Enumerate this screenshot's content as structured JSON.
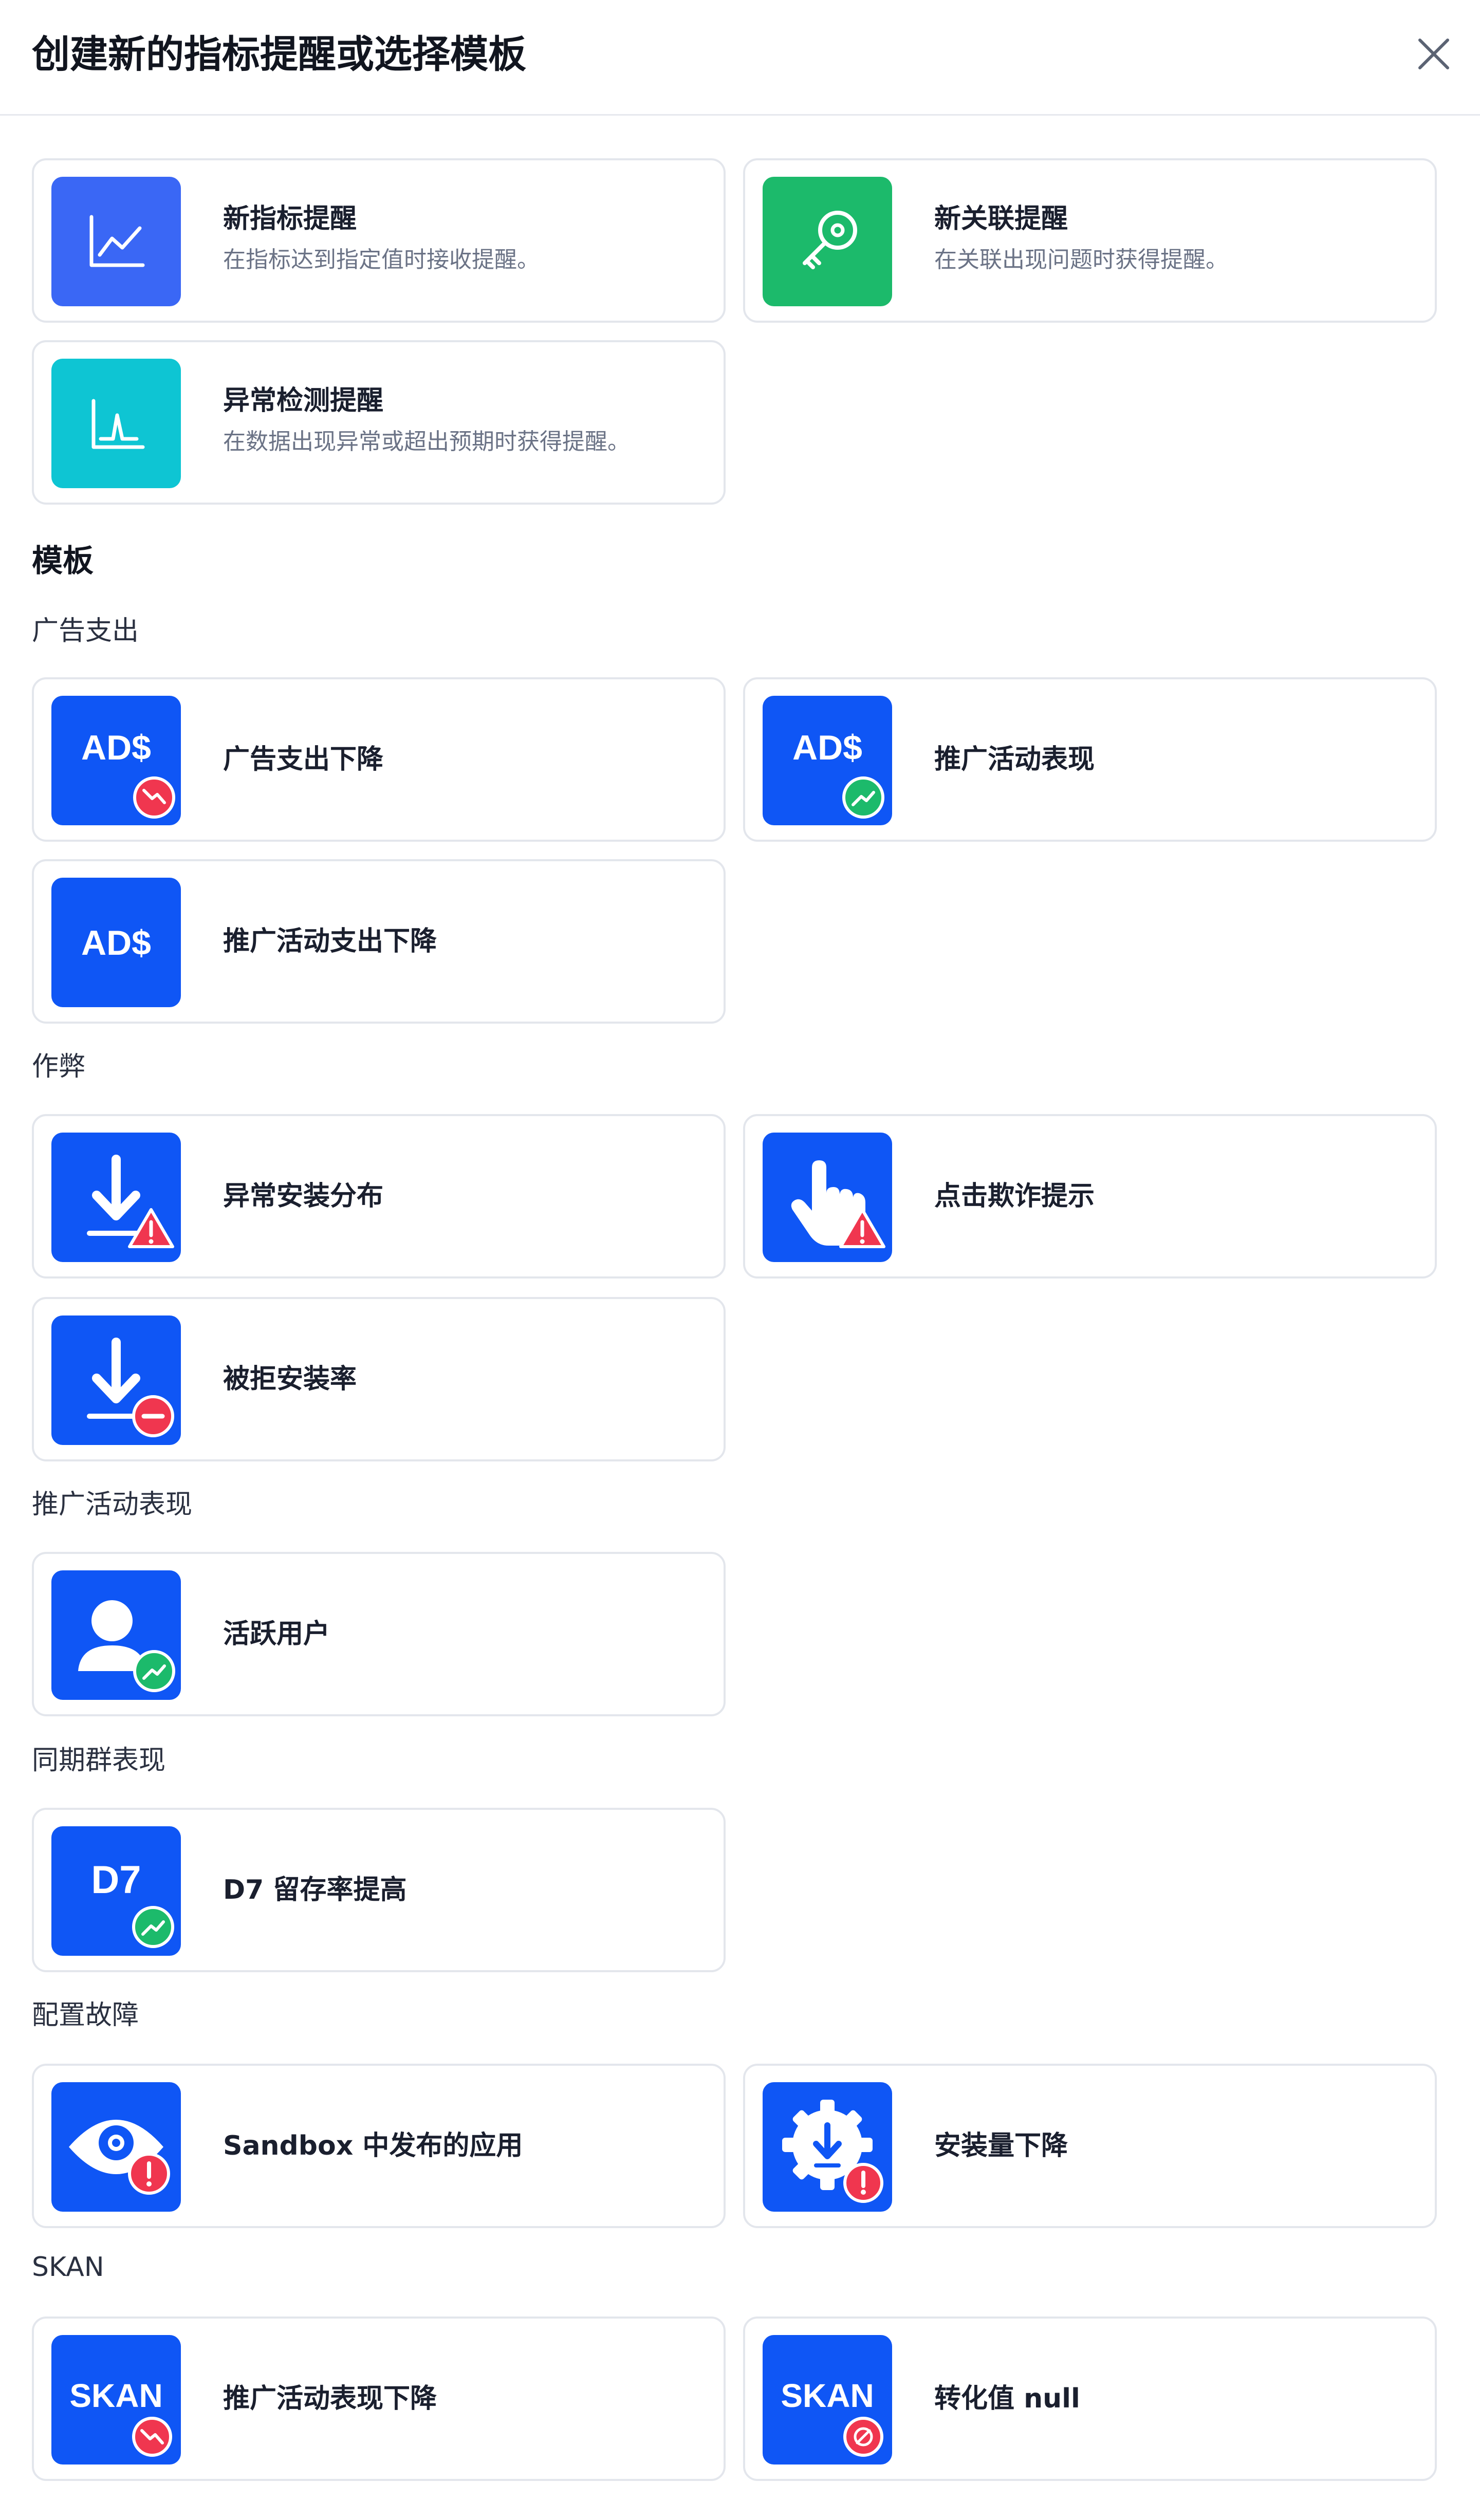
{
  "dialog": {
    "title": "创建新的指标提醒或选择模板"
  },
  "create": [
    {
      "title": "新指标提醒",
      "desc": "在指标达到指定值时接收提醒。"
    },
    {
      "title": "新关联提醒",
      "desc": "在关联出现问题时获得提醒。"
    },
    {
      "title": "异常检测提醒",
      "desc": "在数据出现异常或超出预期时获得提醒。"
    }
  ],
  "templates": {
    "heading": "模板",
    "ad_spend": {
      "label": "广告支出",
      "items": [
        "广告支出下降",
        "推广活动表现",
        "推广活动支出下降"
      ]
    },
    "fraud": {
      "label": "作弊",
      "items": [
        "异常安装分布",
        "点击欺诈提示",
        "被拒安装率"
      ]
    },
    "campaign": {
      "label": "推广活动表现",
      "items": [
        "活跃用户"
      ]
    },
    "cohort": {
      "label": "同期群表现",
      "items": [
        "D7 留存率提高"
      ]
    },
    "config": {
      "label": "配置故障",
      "items": [
        "Sandbox 中发布的应用",
        "安装量下降"
      ]
    },
    "skan": {
      "label": "SKAN",
      "items": [
        "推广活动表现下降",
        "转化值 null"
      ]
    }
  },
  "tile_text": {
    "ads": "AD$",
    "d7": "D7",
    "skan": "SKAN"
  },
  "icons": {
    "close": "close-icon",
    "metric": "line-chart-icon",
    "connection": "key-icon",
    "anomaly": "anomaly-chart-icon",
    "download": "download-icon",
    "hand": "hand-pointer-icon",
    "user": "user-icon",
    "eye": "eye-gear-icon",
    "gear": "gear-download-icon"
  },
  "colors": {
    "tile_blue": "#0f56f5",
    "tile_indigo": "#3a67f5",
    "tile_green": "#1cba6b",
    "tile_teal": "#0ec5d3",
    "badge_red": "#f0364f",
    "badge_green": "#1cba6b",
    "border": "#e3e6ec"
  }
}
